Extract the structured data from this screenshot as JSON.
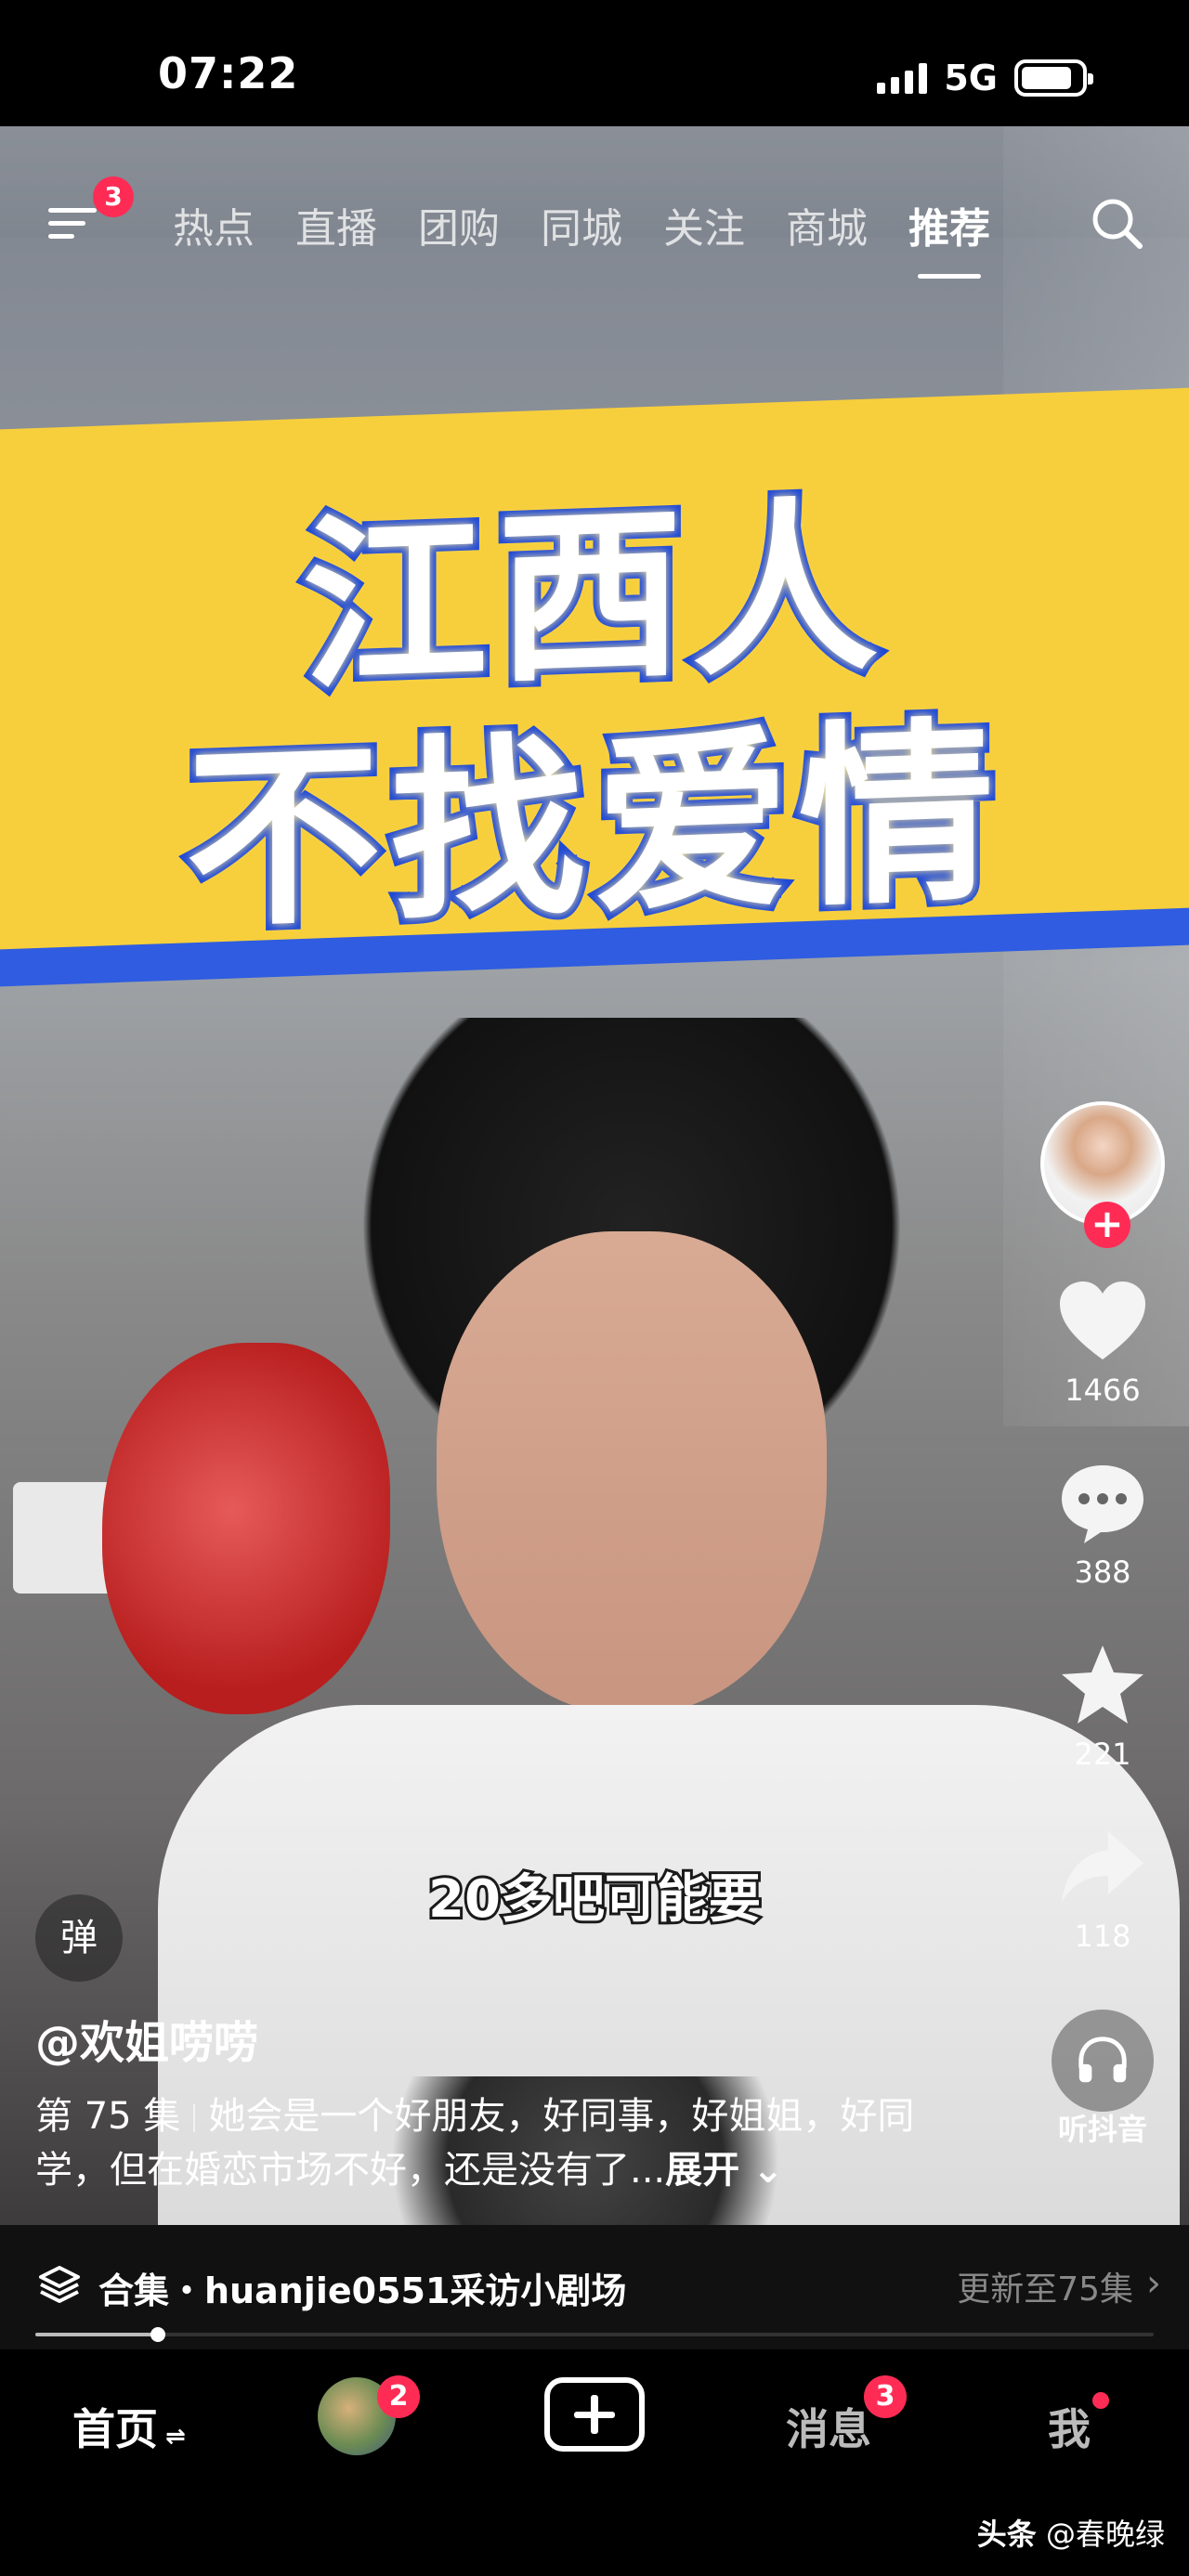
{
  "status": {
    "time": "07:22",
    "network": "5G",
    "battery_level": 0.85
  },
  "topnav": {
    "menu_badge": "3",
    "tabs": [
      "热点",
      "直播",
      "团购",
      "同城",
      "关注",
      "商城",
      "推荐"
    ],
    "active_tab": "推荐"
  },
  "video": {
    "banner_line1": "江西人",
    "banner_line2": "不找爱情",
    "subtitle": "20多吧可能要",
    "banner_colors": {
      "yellow": "#f7cf3c",
      "blue": "#2f5ce0"
    }
  },
  "side_actions": {
    "like_count": "1466",
    "comment_count": "388",
    "favorite_count": "221",
    "share_count": "118",
    "listen_label": "听抖音"
  },
  "caption": {
    "danmu_label": "弹",
    "author": "@欢姐唠唠",
    "episode": "第 75 集",
    "text": "她会是一个好朋友，好同事，好姐姐，好同学，但在婚恋市场不好，还是没有了...",
    "expand": "展开"
  },
  "collection": {
    "name": "合集・huanjie0551采访小剧场",
    "update": "更新至75集",
    "progress": 0.11
  },
  "bottom_nav": {
    "home": "首页",
    "friend_badge": "2",
    "messages": "消息",
    "messages_badge": "3",
    "me": "我"
  },
  "watermark": {
    "source": "头条",
    "author": "@春晚绿"
  },
  "colors": {
    "accent": "#fe2c55"
  }
}
